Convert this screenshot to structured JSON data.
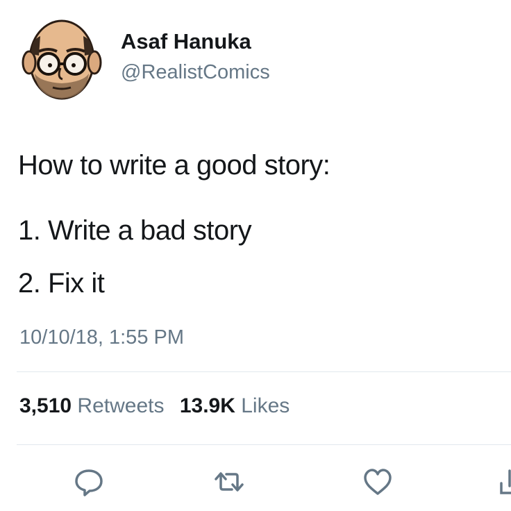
{
  "author": {
    "name": "Asaf Hanuka",
    "handle": "@RealistComics"
  },
  "tweet": {
    "lines": [
      "How to write a good story:",
      "1. Write a bad story",
      "2. Fix it"
    ],
    "timestamp": "10/10/18, 1:55 PM"
  },
  "stats": {
    "retweets_count": "3,510",
    "retweets_label": "Retweets",
    "likes_count": "13.9K",
    "likes_label": "Likes"
  },
  "actions": [
    {
      "icon": "reply-icon"
    },
    {
      "icon": "retweet-icon"
    },
    {
      "icon": "like-heart-icon"
    },
    {
      "icon": "share-icon"
    }
  ],
  "colors": {
    "text_primary": "#14171a",
    "text_secondary": "#657786",
    "divider": "#e1e8ed",
    "icon": "#657786"
  }
}
